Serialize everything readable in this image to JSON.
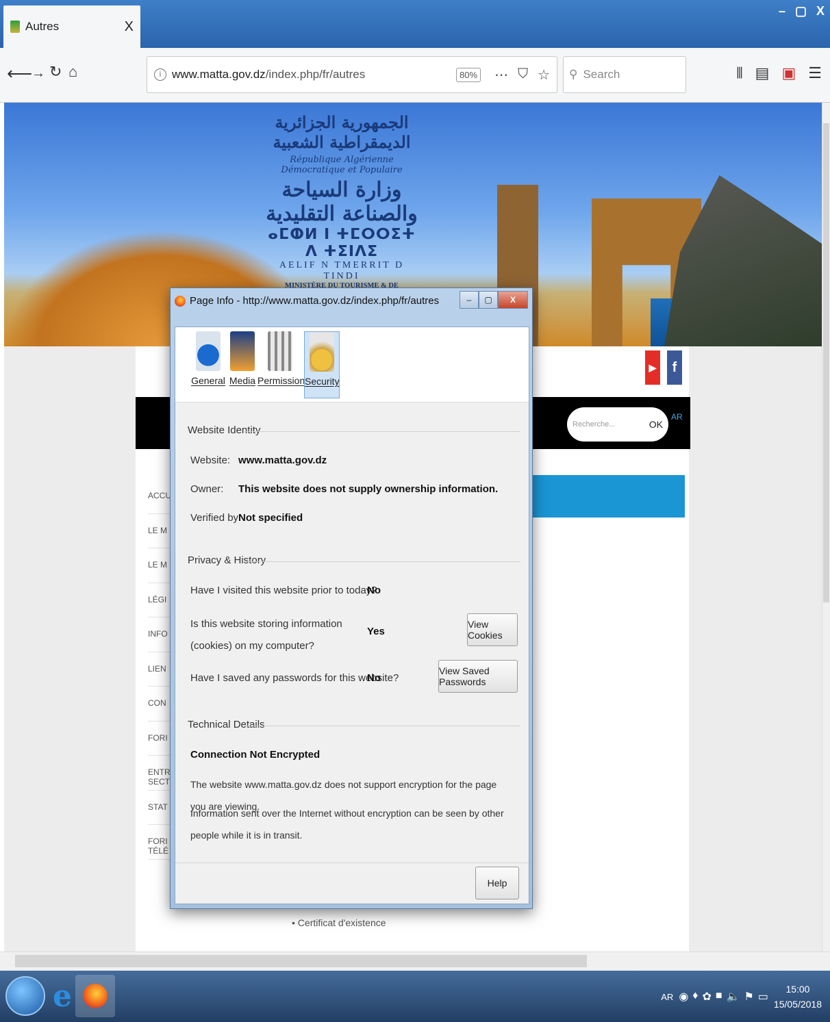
{
  "browser": {
    "tab_title": "Autres",
    "tab_close": "X",
    "window_controls": [
      "–",
      "▢",
      "X"
    ],
    "url_prefix": "www.matta.gov.dz",
    "url_path": "/index.php/fr/autres",
    "zoom": "80%",
    "search_placeholder": "Search",
    "nav_icons": [
      "back-icon",
      "forward-icon",
      "reload-icon",
      "home-icon"
    ]
  },
  "site": {
    "ministry_ar_line1": "الجمهورية الجزائرية الديمقراطية الشعبية",
    "ministry_fr_line1": "République Algérienne Démocratique et Populaire",
    "ministry_ar_line2": "وزارة السياحة والصناعة التقليدية",
    "ministry_tifinagh": "ⴰⵎⵀⵍ ⵏ ⵜⵎⵔⵔⵉⵜ ⴷ ⵜⵉⵏⴷⵉ",
    "ministry_latin": "AELIF N TMERRIT D TINDI",
    "ministry_fr": "MINISTÈRE DU TOURISME & DE L'ARTISANAT",
    "search_placeholder": "Recherche...",
    "search_button": "OK",
    "lang": "AR",
    "side_menu": [
      "ACCU",
      "LE M",
      "LE M",
      "LÉGI",
      "INFO",
      "LIEN",
      "CON",
      "FORI",
      "ENTR SECT",
      "STAT",
      "FORI TÉLÉ"
    ],
    "cert_link": "• Certificat d'existence"
  },
  "dialog": {
    "title": "Page Info - http://www.matta.gov.dz/index.php/fr/autres",
    "tabs": [
      {
        "label": "General"
      },
      {
        "label": "Media"
      },
      {
        "label": "Permissions"
      },
      {
        "label": "Security"
      }
    ],
    "identity": {
      "heading": "Website Identity",
      "website_label": "Website:",
      "website_value": "www.matta.gov.dz",
      "owner_label": "Owner:",
      "owner_value": "This website does not supply ownership information.",
      "verified_label": "Verified by:",
      "verified_value": "Not specified"
    },
    "privacy": {
      "heading": "Privacy & History",
      "q1": "Have I visited this website prior to today?",
      "a1": "No",
      "q2": "Is this website storing information (cookies) on my computer?",
      "a2": "Yes",
      "view_cookies": "View Cookies",
      "q3": "Have I saved any passwords for this website?",
      "a3": "No",
      "view_passwords": "View Saved Passwords"
    },
    "technical": {
      "heading": "Technical Details",
      "status": "Connection Not Encrypted",
      "line1": "The website www.matta.gov.dz does not support encryption for the page you are viewing.",
      "line2": "Information sent over the Internet without encryption can be seen by other people while it is in transit."
    },
    "help": "Help"
  },
  "taskbar": {
    "lang": "AR",
    "time": "15:00",
    "date": "15/05/2018"
  }
}
